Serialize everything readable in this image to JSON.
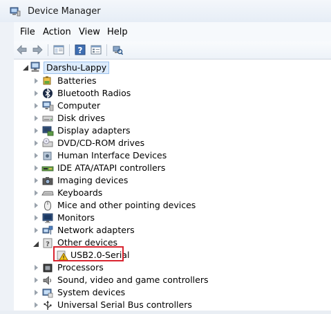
{
  "window": {
    "title": "Device Manager",
    "title_icon": "device-manager-icon"
  },
  "menu": {
    "items": [
      "File",
      "Action",
      "View",
      "Help"
    ]
  },
  "toolbar": {
    "buttons": [
      "back-arrow-icon",
      "forward-arrow-icon",
      "show-hide-console-tree-icon",
      "help-icon",
      "properties-icon",
      "scan-hardware-icon"
    ]
  },
  "tree": {
    "root": {
      "label": "Darshu-Lappy",
      "icon": "computer-icon",
      "expanded": true
    },
    "categories": [
      {
        "label": "Batteries",
        "icon": "battery-icon",
        "expanded": false
      },
      {
        "label": "Bluetooth Radios",
        "icon": "bluetooth-icon",
        "expanded": false
      },
      {
        "label": "Computer",
        "icon": "computer-icon",
        "expanded": false
      },
      {
        "label": "Disk drives",
        "icon": "disk-drive-icon",
        "expanded": false
      },
      {
        "label": "Display adapters",
        "icon": "display-adapter-icon",
        "expanded": false
      },
      {
        "label": "DVD/CD-ROM drives",
        "icon": "dvd-drive-icon",
        "expanded": false
      },
      {
        "label": "Human Interface Devices",
        "icon": "hid-icon",
        "expanded": false
      },
      {
        "label": "IDE ATA/ATAPI controllers",
        "icon": "ide-controller-icon",
        "expanded": false
      },
      {
        "label": "Imaging devices",
        "icon": "camera-icon",
        "expanded": false
      },
      {
        "label": "Keyboards",
        "icon": "keyboard-icon",
        "expanded": false
      },
      {
        "label": "Mice and other pointing devices",
        "icon": "mouse-icon",
        "expanded": false
      },
      {
        "label": "Monitors",
        "icon": "monitor-icon",
        "expanded": false
      },
      {
        "label": "Network adapters",
        "icon": "network-adapter-icon",
        "expanded": false
      },
      {
        "label": "Other devices",
        "icon": "unknown-device-icon",
        "expanded": true
      },
      {
        "label": "Processors",
        "icon": "processor-icon",
        "expanded": false
      },
      {
        "label": "Sound, video and game controllers",
        "icon": "speaker-icon",
        "expanded": false
      },
      {
        "label": "System devices",
        "icon": "system-device-icon",
        "expanded": false
      },
      {
        "label": "Universal Serial Bus controllers",
        "icon": "usb-icon",
        "expanded": false
      }
    ],
    "other_devices_children": [
      {
        "label": "USB2.0-Serial",
        "icon": "warning-device-icon",
        "highlighted": true
      }
    ]
  },
  "colors": {
    "highlight_border": "#d9232e",
    "root_selection": "#dcebfc"
  }
}
